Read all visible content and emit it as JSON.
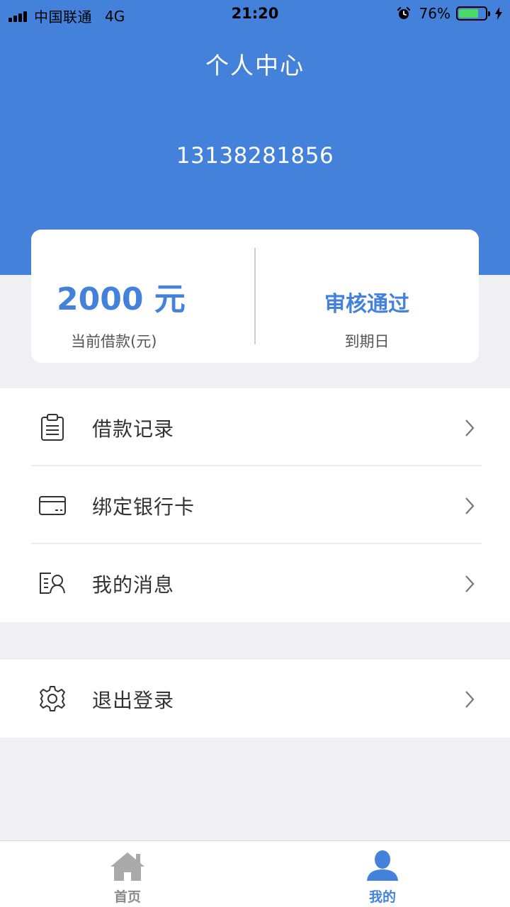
{
  "status_bar": {
    "carrier": "中国联通",
    "network": "4G",
    "time": "21:20",
    "battery": "76%",
    "battery_level": 0.76
  },
  "header": {
    "title": "个人中心",
    "phone": "13138281856"
  },
  "summary": {
    "amount": "2000 元",
    "amount_label": "当前借款(元)",
    "status": "审核通过",
    "status_label": "到期日"
  },
  "menu": {
    "loan_records": "借款记录",
    "bind_card": "绑定银行卡",
    "messages": "我的消息",
    "logout": "退出登录"
  },
  "tabbar": {
    "home": "首页",
    "mine": "我的"
  },
  "colors": {
    "accent": "#4481da",
    "background": "#efeff4",
    "battery": "#4cd964"
  }
}
